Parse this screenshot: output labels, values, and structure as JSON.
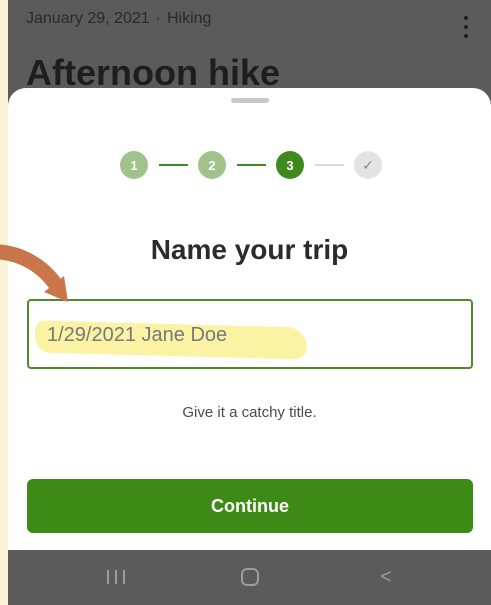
{
  "background": {
    "date": "January 29, 2021",
    "separator": "·",
    "activity": "Hiking",
    "title": "Afternoon hike",
    "menu_icon": "more-vertical-icon"
  },
  "stepper": {
    "steps": [
      {
        "label": "1",
        "state": "done"
      },
      {
        "label": "2",
        "state": "done"
      },
      {
        "label": "3",
        "state": "active"
      },
      {
        "label": "✓",
        "state": "pending"
      }
    ]
  },
  "sheet": {
    "title": "Name your trip",
    "trip_name_value": "1/29/2021 Jane Doe",
    "helper": "Give it a catchy title.",
    "continue_label": "Continue"
  },
  "navbar": {
    "recents_icon": "recents-icon",
    "home_icon": "home-icon",
    "back_label": "<"
  },
  "colors": {
    "accent": "#3e8a17",
    "step_done": "#9fc38a",
    "annotation_arrow": "#c8764a",
    "highlight": "#fbf29a"
  }
}
